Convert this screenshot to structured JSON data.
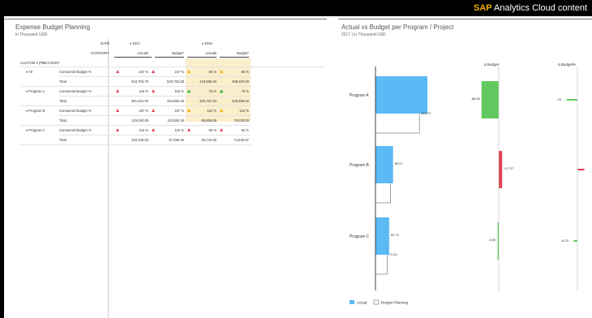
{
  "brand": {
    "sap": "SAP",
    "rest": " Analytics Cloud content"
  },
  "left": {
    "title": "Expense Budget Planning",
    "subtitle": "in Thousand USD",
    "header": {
      "date_label": "DATE",
      "category_label": "CATEGORY",
      "dim1": "CUSTOM 2 (PR...",
      "dim2": "ACCOUNT",
      "year1": "▾ 2017",
      "year2": "▾ 2016",
      "actuals1": "Actuals",
      "budget1": "Budget*",
      "actuals2": "Actuals",
      "budget2": "Budget*"
    },
    "rows": [
      {
        "dim": "▾ All",
        "account": "Consumed Budget %",
        "a17": "157 %",
        "b17": "157 %",
        "a16": "85 %",
        "b16": "85 %",
        "a17_icon": "red-triangle",
        "b17_icon": "red-triangle",
        "a16_icon": "amber-triangle",
        "b16_icon": "amber-triangle"
      },
      {
        "dim": "",
        "account": "Total",
        "a17": "610,750.76",
        "b17": "520,752.58",
        "a16": "415,096.20",
        "b16": "499,300.00"
      },
      {
        "dim": "▾ Program A",
        "account": "Consumed Budget %",
        "a17": "118 %",
        "b17": "118 %",
        "a16": "75 %",
        "b16": "75 %",
        "a17_icon": "red-triangle",
        "b17_icon": "red-triangle",
        "a16_icon": "green-dot",
        "b16_icon": "green-dot"
      },
      {
        "dim": "",
        "account": "Total",
        "a17": "381,251.00",
        "b17": "322,592.23",
        "a16": "260,787.43",
        "b16": "349,366.62"
      },
      {
        "dim": "▾ Program B",
        "account": "Consumed Budget %",
        "a17": "157 %",
        "b17": "157 %",
        "a16": "122 %",
        "b16": "122 %",
        "a17_icon": "red-triangle",
        "b17_icon": "red-triangle",
        "a16_icon": "amber-triangle",
        "b16_icon": "amber-triangle"
      },
      {
        "dim": "",
        "account": "Total",
        "a17": "129,160.05",
        "b17": "110,680.16",
        "a16": "95,566.65",
        "b16": "78,293.00"
      },
      {
        "dim": "▾ Program C",
        "account": "Consumed Budget %",
        "a17": "115 %",
        "b17": "115 %",
        "a16": "92 %",
        "b16": "92 %",
        "a17_icon": "red-triangle",
        "b17_icon": "red-triangle",
        "a16_icon": "red-triangle",
        "b16_icon": "red-triangle"
      },
      {
        "dim": "",
        "account": "Total",
        "a17": "100,339.63",
        "b17": "87,480.20",
        "a16": "65,741.92",
        "b16": "71,640.67"
      }
    ]
  },
  "right": {
    "title": "Actual vs Budget per Program / Project",
    "subtitle": "2017 | in Thousand USD",
    "delta_budget_label": "Δ Budget",
    "delta_budget_pct_label": "Δ Budget%",
    "legend": {
      "actual": "Actual",
      "budget": "Budget Planning"
    },
    "colors": {
      "actual": "#5bb9f5",
      "positive": "#61c95f",
      "negative": "#e34352"
    }
  },
  "chart_data": {
    "type": "bar",
    "title": "Actual vs Budget per Program / Project",
    "subtitle": "2017 | in Thousand USD",
    "categories": [
      "Program A",
      "Program B",
      "Program C"
    ],
    "series": [
      {
        "name": "Actual",
        "values": [
          381.25,
          129.16,
          100.34
        ]
      },
      {
        "name": "Budget Planning",
        "values": [
          322.59,
          110.68,
          87.48
        ]
      }
    ],
    "delta_budget": {
      "label": "Δ Budget",
      "values": [
        -88.58,
        17.27,
        -5.9
      ],
      "value_labels": [
        "-88.58",
        "+17.27",
        "-5.90"
      ]
    },
    "delta_budget_pct": {
      "label": "Δ Budget%",
      "values": [
        -23.0,
        15.0,
        -8.23
      ],
      "value_labels": [
        "-23 ...",
        "",
        "-8.23 ..."
      ]
    },
    "bar_end_labels": {
      "actual": [
        "",
        "85.57",
        "62.74"
      ],
      "budget": [
        "349.37",
        "",
        "71.64"
      ]
    },
    "legend_position": "bottom-left",
    "grid": false
  }
}
